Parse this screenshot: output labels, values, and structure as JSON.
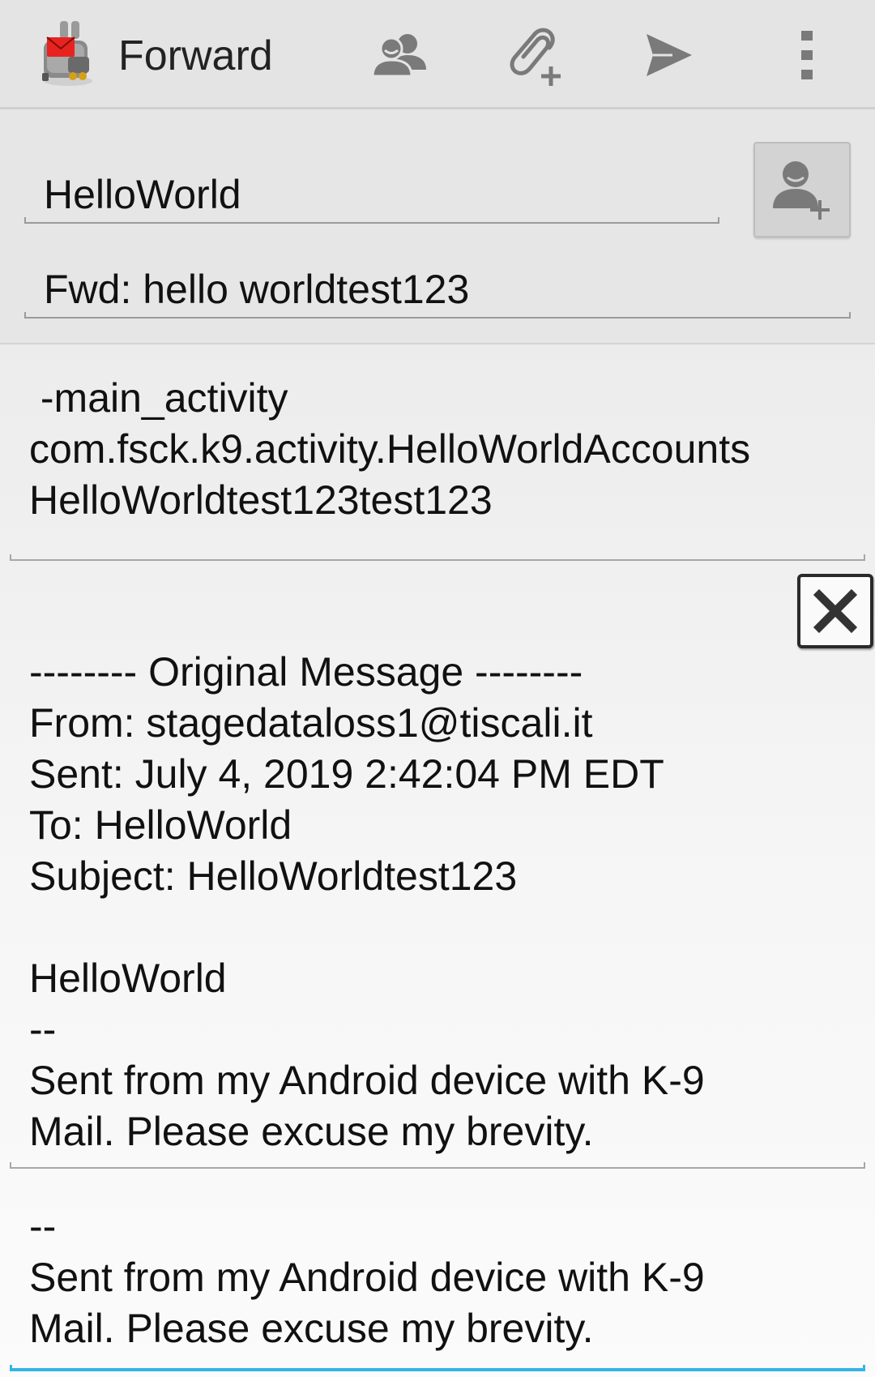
{
  "action_bar": {
    "title": "Forward",
    "app_icon": "k9-mail-icon",
    "buttons": [
      {
        "name": "add-recipients-button",
        "icon": "contacts-icon"
      },
      {
        "name": "add-attachment-button",
        "icon": "paperclip-add-icon"
      },
      {
        "name": "send-button",
        "icon": "send-icon"
      },
      {
        "name": "overflow-menu-button",
        "icon": "more-vert-icon"
      }
    ]
  },
  "header": {
    "to_value": "HelloWorld",
    "subject_value": "Fwd: hello worldtest123",
    "add_contact_icon": "person-add-icon"
  },
  "body": {
    "message_text": " -main_activity\ncom.fsck.k9.activity.HelloWorldAccounts\nHelloWorldtest123test123",
    "quote_close_icon": "close-icon",
    "quoted_text": "-------- Original Message --------\nFrom: stagedataloss1@tiscali.it\nSent: July 4, 2019 2:42:04 PM EDT\nTo: HelloWorld\nSubject: HelloWorldtest123\n\nHelloWorld\n--\nSent from my Android device with K-9\nMail. Please excuse my brevity.",
    "signature_text": "--\nSent from my Android device with K-9\nMail. Please excuse my brevity."
  },
  "colors": {
    "action_bar_bg": "#e4e4e4",
    "icon_gray": "#7a7a7a",
    "focus_accent": "#33b5e5"
  }
}
